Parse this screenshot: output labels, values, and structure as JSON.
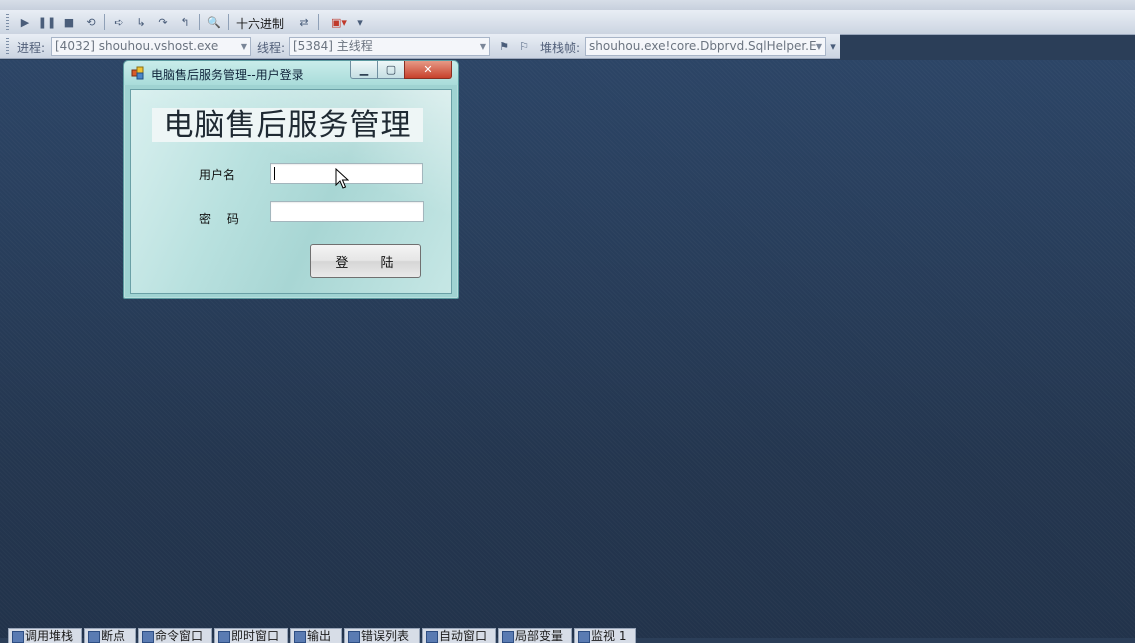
{
  "toolbar2": {
    "hex_label": "十六进制"
  },
  "debug_location": {
    "process_label": "进程:",
    "process_value": "[4032] shouhou.vshost.exe",
    "thread_label": "线程:",
    "thread_value": "[5384] 主线程",
    "stackframe_label": "堆栈帧:",
    "stackframe_value": "shouhou.exe!core.Dbprvd.SqlHelper.E"
  },
  "login_window": {
    "title": "电脑售后服务管理--用户登录",
    "banner": "电脑售后服务管理",
    "username_label": "用户名",
    "username_value": "",
    "password_label": "密 码",
    "password_value": "",
    "login_button": "登 陆"
  },
  "bottom_tabs": [
    "调用堆栈",
    "断点",
    "命令窗口",
    "即时窗口",
    "输出",
    "错误列表",
    "自动窗口",
    "局部变量",
    "监视 1"
  ],
  "colors": {
    "workspace": "#2b3e58",
    "window_frame": "#9fd3d2",
    "close_button": "#c7412c"
  }
}
